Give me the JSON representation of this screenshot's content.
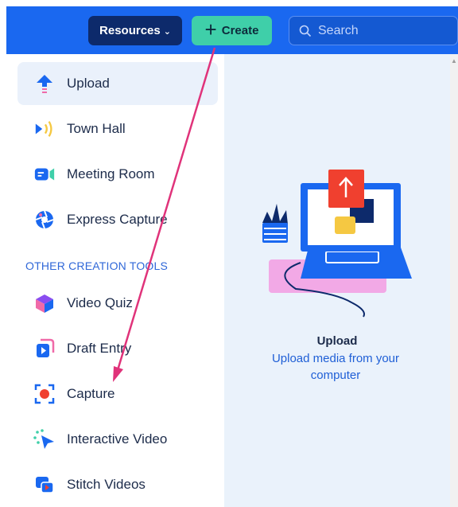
{
  "header": {
    "resources_label": "Resources",
    "create_label": "Create",
    "search_placeholder": "Search"
  },
  "menu": {
    "items": [
      {
        "label": "Upload",
        "icon": "upload-icon",
        "active": true
      },
      {
        "label": "Town Hall",
        "icon": "town-hall-icon"
      },
      {
        "label": "Meeting Room",
        "icon": "meeting-room-icon"
      },
      {
        "label": "Express Capture",
        "icon": "express-capture-icon"
      }
    ],
    "section_label": "OTHER CREATION TOOLS",
    "tools": [
      {
        "label": "Video Quiz",
        "icon": "video-quiz-icon"
      },
      {
        "label": "Draft Entry",
        "icon": "draft-entry-icon"
      },
      {
        "label": "Capture",
        "icon": "capture-icon"
      },
      {
        "label": "Interactive Video",
        "icon": "interactive-video-icon"
      },
      {
        "label": "Stitch Videos",
        "icon": "stitch-videos-icon"
      }
    ]
  },
  "preview": {
    "title": "Upload",
    "description": "Upload media from your computer"
  },
  "colors": {
    "topbar": "#1a68f0",
    "resources_bg": "#0d2a6b",
    "create_bg": "#3fcfa9",
    "annotation_arrow": "#e0337a"
  }
}
